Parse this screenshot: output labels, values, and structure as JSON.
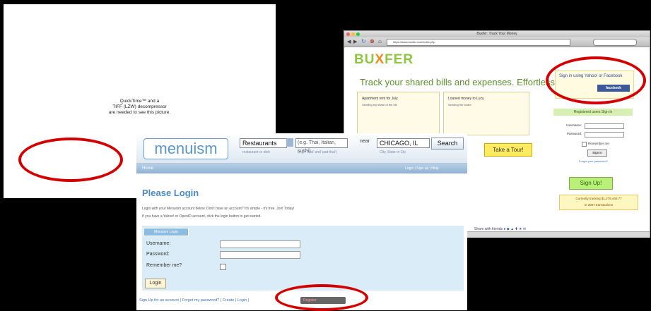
{
  "quicktime": {
    "line1": "QuickTime™ and a",
    "line2": "TIFF (LZW) decompressor",
    "line3": "are needed to see this picture."
  },
  "buxfer": {
    "window_title": "Buxfer: Track Your Money",
    "url": "https://www.buxfer.com/index.php",
    "logo_part1": "BU",
    "logo_x": "X",
    "logo_part2": "FER",
    "tagline": "Track your shared bills and expenses. Effortlessly.",
    "box1_title": "Apartment rent for July",
    "box1_text": "Sending my share of the bill",
    "box2_title": "Loaned money to Lucy",
    "box2_text": "Sending her share",
    "tour_button": "Take a Tour!",
    "fb_text": "Sign in using Yahoo! or Facebook",
    "fb_button": "facebook",
    "reg_bar": "Registered users  Sign in",
    "username_label": "Username:",
    "password_label": "Password:",
    "remember": "Remember me",
    "signin_button": "Sign in",
    "forgot": "Forgot your password?",
    "signup_button": "Sign Up!",
    "saving_line1": "Currently tracking $1,279,440.77",
    "saving_line2": "in 2007 transactions",
    "share_text": "Share with friends"
  },
  "menuism": {
    "logo": "menuism",
    "what_value": "Restaurants",
    "query": "(e.g. Thai, Italian, sushi)",
    "near_label": "near",
    "city_value": "CHICAGO, IL",
    "search_button": "Search",
    "hint1": "restaurant or dish",
    "hint2": "(e.g. 'Thai' and 'pad thai')",
    "hint3": "City, State or Zip",
    "nav_home": "Home",
    "nav_right": "Login  |  Sign up  |  Help",
    "title": "Please Login",
    "p1": "Login with your Menuism account below. Don't have an account? It's simple - it's free. Join Today!",
    "p2": "If you have a Yahoo! or OpenID account, click the login button to get started.",
    "tab": "Menuism Login",
    "username_label": "Username:",
    "password_label": "Password:",
    "remember_label": "Remember me?",
    "login_button": "Login",
    "links": "Sign Up for an account | Forgot my password? |  Create  | Login  |",
    "reg_button": "Register"
  }
}
